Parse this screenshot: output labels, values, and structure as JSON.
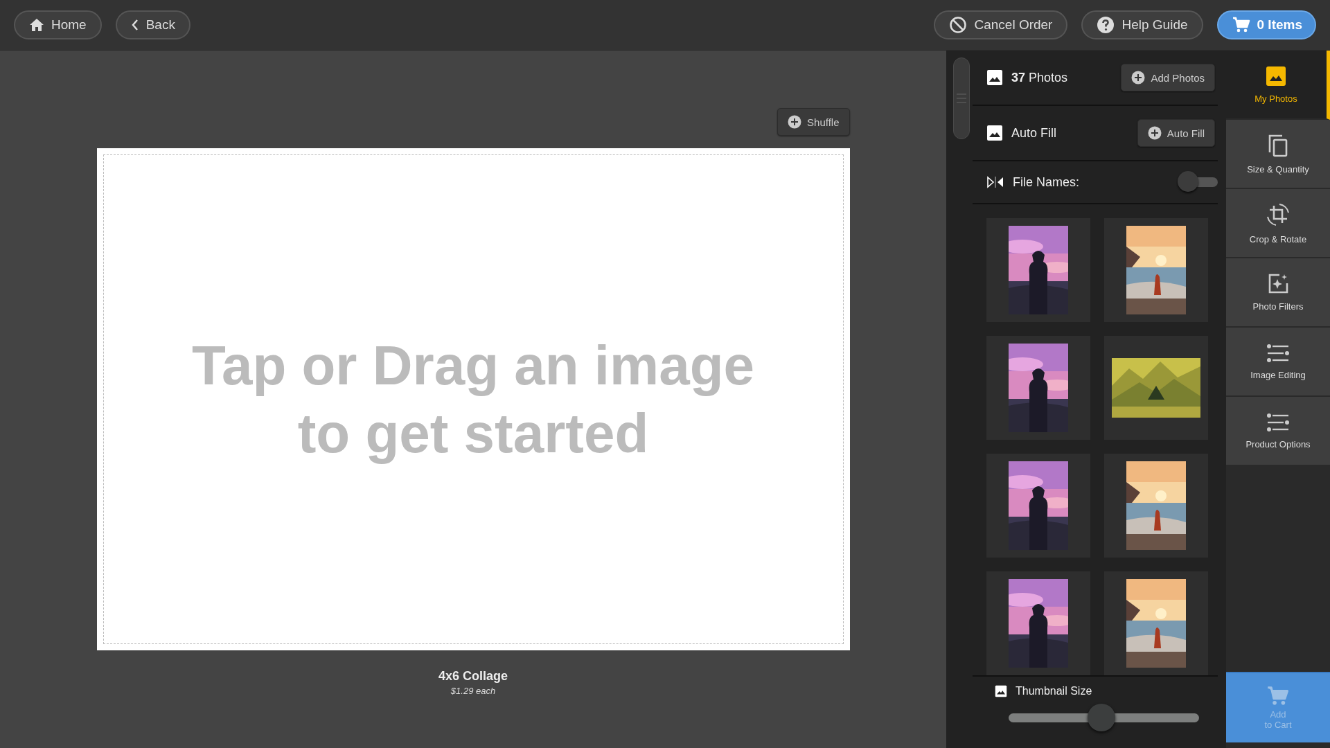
{
  "top_bar": {
    "left_buttons": [
      {
        "kind": "home",
        "label": "Home"
      },
      {
        "kind": "back",
        "label": "Back"
      }
    ],
    "right_buttons": [
      {
        "kind": "cancel",
        "label": "Cancel Order",
        "primary": false
      },
      {
        "kind": "help",
        "label": "Help Guide",
        "primary": false
      },
      {
        "kind": "cart",
        "label": "0 Items",
        "primary": true
      }
    ]
  },
  "canvas": {
    "shuffle_button": "Shuffle",
    "placeholder": "Tap or Drag an image to get started",
    "product_name": "4x6 Collage",
    "price": "$1.29 each"
  },
  "photos_panel": {
    "count": "37",
    "count_label": "Photos",
    "add_button": "Add Photos",
    "auto_fill_label": "Auto Fill",
    "auto_fill_button": "Auto Fill",
    "file_names_label": "File Names:",
    "file_names_on": false,
    "thumbnail_size": {
      "label": "Thumbnail Size",
      "level": 0.49
    }
  },
  "sidebar": {
    "items": [
      {
        "kind": "photos",
        "label": "My Photos",
        "selected": true
      },
      {
        "kind": "size",
        "label": "Size & Quantity",
        "selected": false
      },
      {
        "kind": "crop",
        "label": "Crop & Rotate",
        "selected": false
      },
      {
        "kind": "filters",
        "label": "Photo Filters",
        "selected": false
      },
      {
        "kind": "editing",
        "label": "Image Editing",
        "selected": false
      },
      {
        "kind": "options",
        "label": "Product Options",
        "selected": false
      }
    ],
    "add_to_cart": {
      "label": "Add\nto Cart",
      "disabled": true
    }
  }
}
